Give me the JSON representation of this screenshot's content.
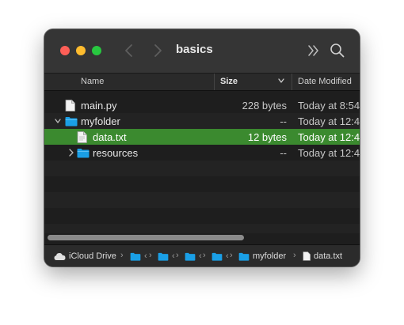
{
  "window": {
    "title": "basics"
  },
  "columns": {
    "name": "Name",
    "size": "Size",
    "date_modified": "Date Modified"
  },
  "files": [
    {
      "name": "main.py",
      "size": "228 bytes",
      "date": "Today at 8:54",
      "type": "file",
      "indent": 0,
      "expanded": false
    },
    {
      "name": "myfolder",
      "size": "--",
      "date": "Today at 12:4",
      "type": "folder",
      "indent": 0,
      "expanded": true
    },
    {
      "name": "data.txt",
      "size": "12 bytes",
      "date": "Today at 12:4",
      "type": "file",
      "indent": 1,
      "selected": true
    },
    {
      "name": "resources",
      "size": "--",
      "date": "Today at 12:4",
      "type": "folder",
      "indent": 1,
      "expanded": false
    }
  ],
  "pathbar": {
    "root": "iCloud Drive",
    "hidden_segment": "‹",
    "folder": "myfolder",
    "file": "data.txt",
    "separator": "›"
  },
  "colors": {
    "selection": "#3b8a2f",
    "folder": "#1a9fe6",
    "window_bg": "#1e1e1e",
    "titlebar_bg": "#353535"
  }
}
